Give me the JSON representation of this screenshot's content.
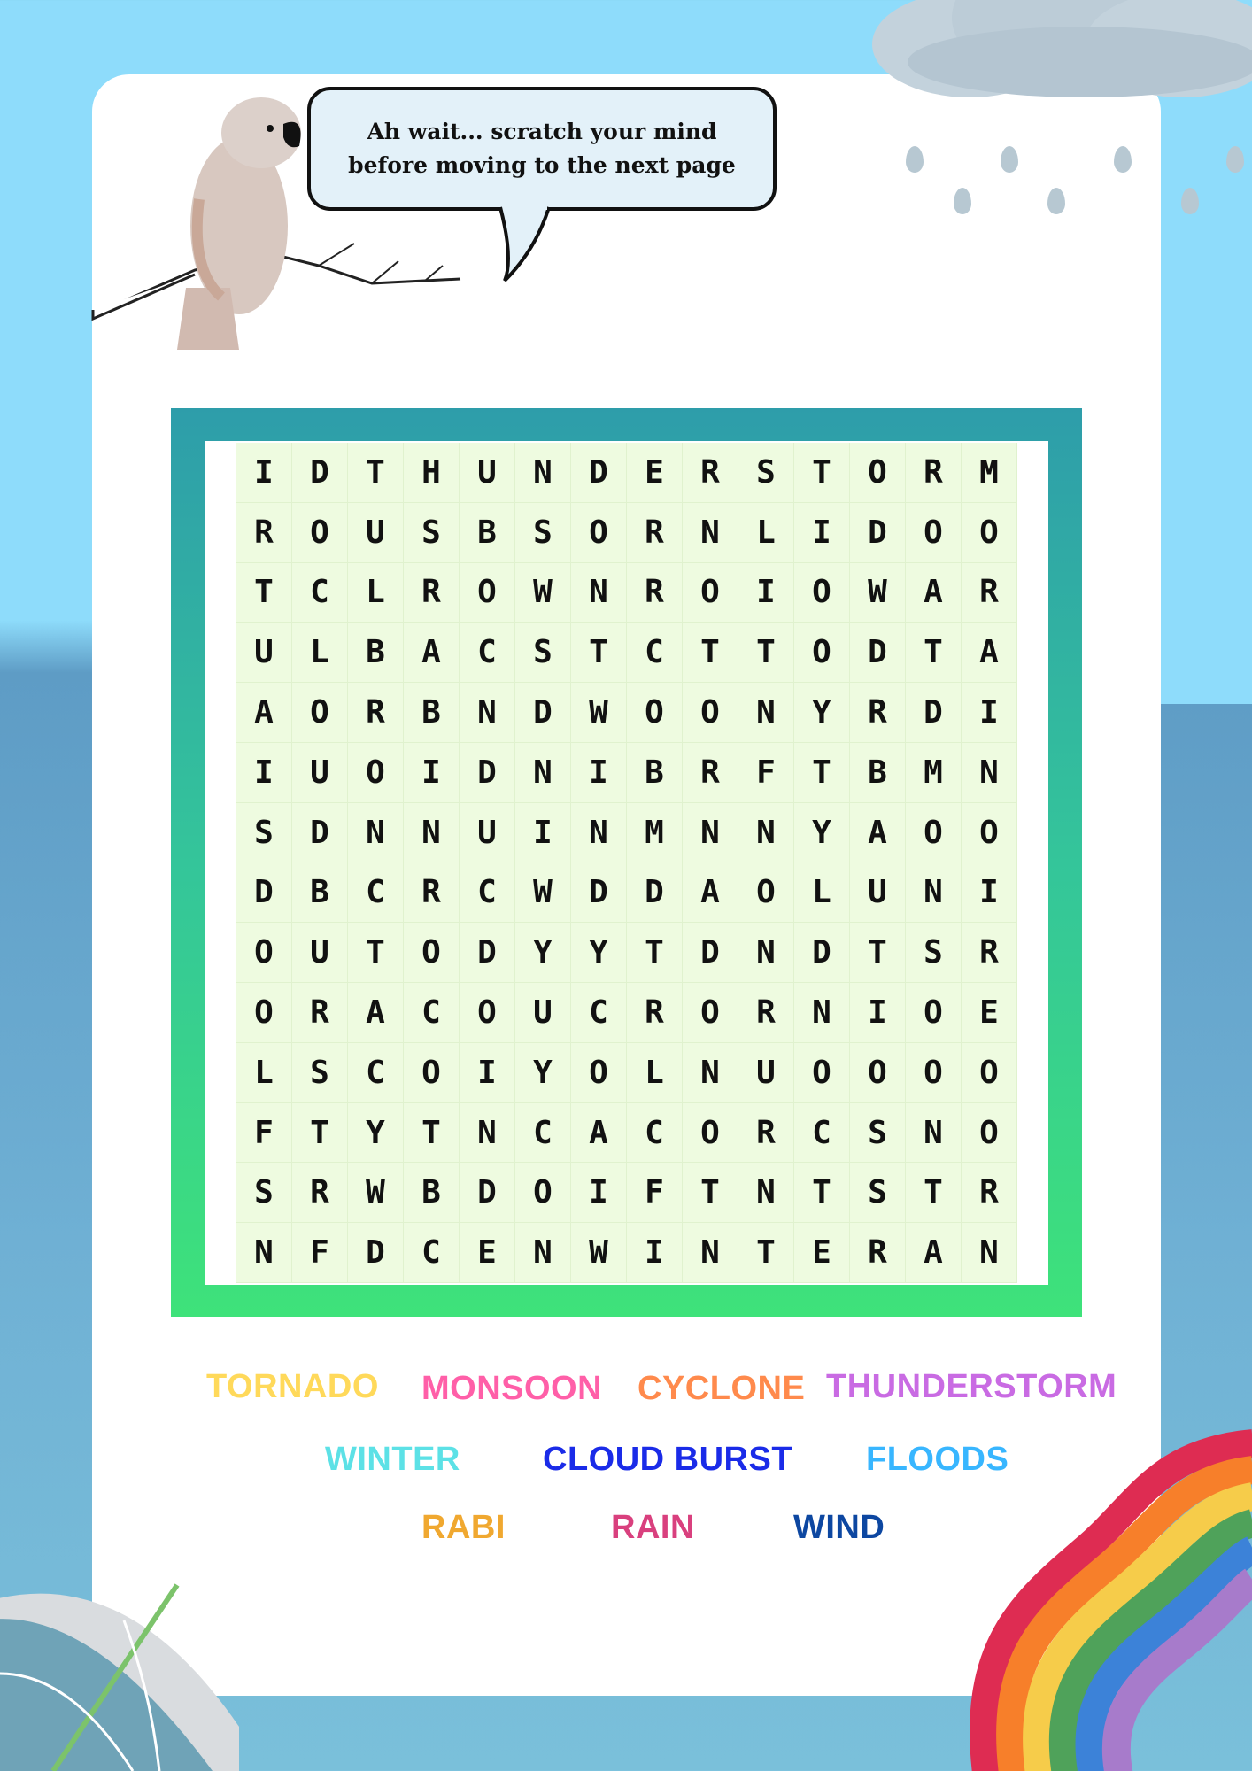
{
  "speech_bubble": {
    "text": "Ah wait... scratch your mind before moving to the next page"
  },
  "puzzle": {
    "rows": [
      [
        "I",
        "D",
        "T",
        "H",
        "U",
        "N",
        "D",
        "E",
        "R",
        "S",
        "T",
        "O",
        "R",
        "M"
      ],
      [
        "R",
        "O",
        "U",
        "S",
        "B",
        "S",
        "O",
        "R",
        "N",
        "L",
        "I",
        "D",
        "O",
        "O"
      ],
      [
        "T",
        "C",
        "L",
        "R",
        "O",
        "W",
        "N",
        "R",
        "O",
        "I",
        "O",
        "W",
        "A",
        "R"
      ],
      [
        "U",
        "L",
        "B",
        "A",
        "C",
        "S",
        "T",
        "C",
        "T",
        "T",
        "O",
        "D",
        "T",
        "A"
      ],
      [
        "A",
        "O",
        "R",
        "B",
        "N",
        "D",
        "W",
        "O",
        "O",
        "N",
        "Y",
        "R",
        "D",
        "I"
      ],
      [
        "I",
        "U",
        "O",
        "I",
        "D",
        "N",
        "I",
        "B",
        "R",
        "F",
        "T",
        "B",
        "M",
        "N"
      ],
      [
        "S",
        "D",
        "N",
        "N",
        "U",
        "I",
        "N",
        "M",
        "N",
        "N",
        "Y",
        "A",
        "O",
        "O"
      ],
      [
        "D",
        "B",
        "C",
        "R",
        "C",
        "W",
        "D",
        "D",
        "A",
        "O",
        "L",
        "U",
        "N",
        "I"
      ],
      [
        "O",
        "U",
        "T",
        "O",
        "D",
        "Y",
        "Y",
        "T",
        "D",
        "N",
        "D",
        "T",
        "S",
        "R"
      ],
      [
        "O",
        "R",
        "A",
        "C",
        "O",
        "U",
        "C",
        "R",
        "O",
        "R",
        "N",
        "I",
        "O",
        "E"
      ],
      [
        "L",
        "S",
        "C",
        "O",
        "I",
        "Y",
        "O",
        "L",
        "N",
        "U",
        "O",
        "O",
        "O",
        "O"
      ],
      [
        "F",
        "T",
        "Y",
        "T",
        "N",
        "C",
        "A",
        "C",
        "O",
        "R",
        "C",
        "S",
        "N",
        "O"
      ],
      [
        "S",
        "R",
        "W",
        "B",
        "D",
        "O",
        "I",
        "F",
        "T",
        "N",
        "T",
        "S",
        "T",
        "R"
      ],
      [
        "N",
        "F",
        "D",
        "C",
        "E",
        "N",
        "W",
        "I",
        "N",
        "T",
        "E",
        "R",
        "A",
        "N"
      ]
    ]
  },
  "word_list": [
    {
      "word": "TORNADO",
      "color": "#FFD95A"
    },
    {
      "word": "MONSOON",
      "color": "#FF5FA8"
    },
    {
      "word": "CYCLONE",
      "color": "#FF8A4C"
    },
    {
      "word": "THUNDERSTORM",
      "color": "#C96BE3"
    },
    {
      "word": "WINTER",
      "color": "#5CE1E6"
    },
    {
      "word": "CLOUD BURST",
      "color": "#1A2BE8"
    },
    {
      "word": "FLOODS",
      "color": "#38B6FF"
    },
    {
      "word": "RABI",
      "color": "#F0A830"
    },
    {
      "word": "RAIN",
      "color": "#D9407E"
    },
    {
      "word": "WIND",
      "color": "#0D47A1"
    }
  ]
}
